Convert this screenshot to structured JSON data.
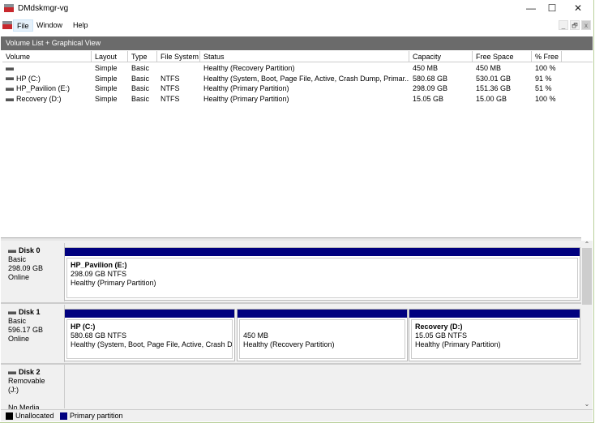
{
  "window": {
    "title": "DMdskmgr-vg",
    "controls": [
      "—",
      "☐",
      "✕"
    ],
    "mdi_controls": [
      "_",
      "🗗",
      "x"
    ]
  },
  "menu": [
    "File",
    "Window",
    "Help"
  ],
  "view_title": "Volume List + Graphical View",
  "columns": [
    "Volume",
    "Layout",
    "Type",
    "File System",
    "Status",
    "Capacity",
    "Free Space",
    "% Free"
  ],
  "volumes": [
    {
      "volume": "",
      "layout": "Simple",
      "type": "Basic",
      "fs": "",
      "status": "Healthy (Recovery Partition)",
      "capacity": "450 MB",
      "free": "450 MB",
      "pct": "100 %"
    },
    {
      "volume": "HP (C:)",
      "layout": "Simple",
      "type": "Basic",
      "fs": "NTFS",
      "status": "Healthy (System, Boot, Page File, Active, Crash Dump, Primar...",
      "capacity": "580.68 GB",
      "free": "530.01 GB",
      "pct": "91 %"
    },
    {
      "volume": "HP_Pavilion (E:)",
      "layout": "Simple",
      "type": "Basic",
      "fs": "NTFS",
      "status": "Healthy (Primary Partition)",
      "capacity": "298.09 GB",
      "free": "151.36 GB",
      "pct": "51 %"
    },
    {
      "volume": "Recovery (D:)",
      "layout": "Simple",
      "type": "Basic",
      "fs": "NTFS",
      "status": "Healthy (Primary Partition)",
      "capacity": "15.05 GB",
      "free": "15.00 GB",
      "pct": "100 %"
    }
  ],
  "disks": [
    {
      "name": "Disk 0",
      "type": "Basic",
      "size": "298.09 GB",
      "state": "Online",
      "partitions": [
        {
          "name": "HP_Pavilion  (E:)",
          "size": "298.09 GB NTFS",
          "status": "Healthy (Primary Partition)"
        }
      ]
    },
    {
      "name": "Disk 1",
      "type": "Basic",
      "size": "596.17 GB",
      "state": "Online",
      "partitions": [
        {
          "name": "HP  (C:)",
          "size": "580.68 GB NTFS",
          "status": "Healthy (System, Boot, Page File, Active, Crash Dun"
        },
        {
          "name": "",
          "size": "450 MB",
          "status": "Healthy (Recovery Partition)"
        },
        {
          "name": "Recovery  (D:)",
          "size": "15.05 GB NTFS",
          "status": "Healthy (Primary Partition)"
        }
      ]
    },
    {
      "name": "Disk 2",
      "type": "Removable (J:)",
      "size": "",
      "state": "No Media",
      "partitions": []
    }
  ],
  "legend": [
    {
      "label": "Unallocated",
      "color": "#000000"
    },
    {
      "label": "Primary partition",
      "color": "#00007f"
    }
  ]
}
